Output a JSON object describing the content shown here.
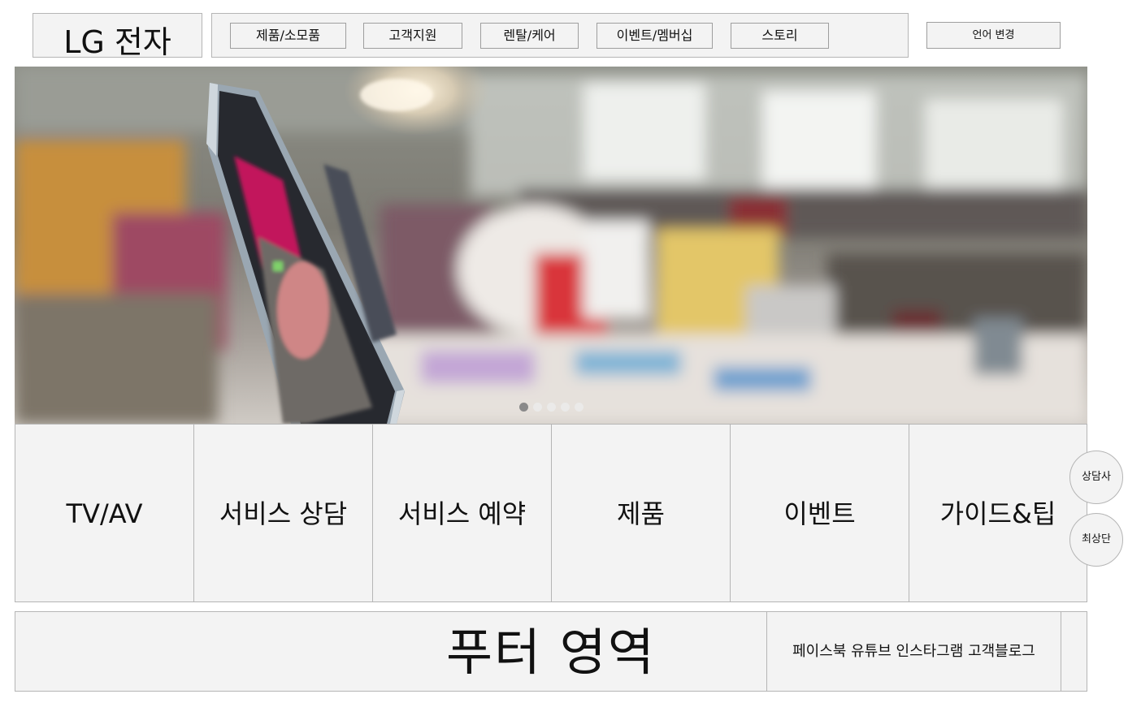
{
  "logo": {
    "text": "LG 전자"
  },
  "nav": {
    "items": [
      {
        "label": "제품/소모품"
      },
      {
        "label": "고객지원"
      },
      {
        "label": "렌탈/케어"
      },
      {
        "label": "이벤트/멤버십"
      },
      {
        "label": "스토리"
      }
    ]
  },
  "language_button": "언어 변경",
  "hero": {
    "slide_count": 5,
    "active_slide": 1
  },
  "quick_menu": [
    {
      "label": "TV/AV"
    },
    {
      "label": "서비스 상담"
    },
    {
      "label": "서비스 예약"
    },
    {
      "label": "제품"
    },
    {
      "label": "이벤트"
    },
    {
      "label": "가이드&팁"
    }
  ],
  "floating": {
    "consult": "상담사",
    "top": "최상단"
  },
  "footer": {
    "title": "푸터 영역",
    "sns": [
      "페이스북",
      "유튜브",
      "인스타그램",
      "고객블로그"
    ]
  },
  "colors": {
    "panel_bg": "#f3f3f3",
    "border": "#b5b5b5",
    "dot_active": "#8a8a8a"
  }
}
